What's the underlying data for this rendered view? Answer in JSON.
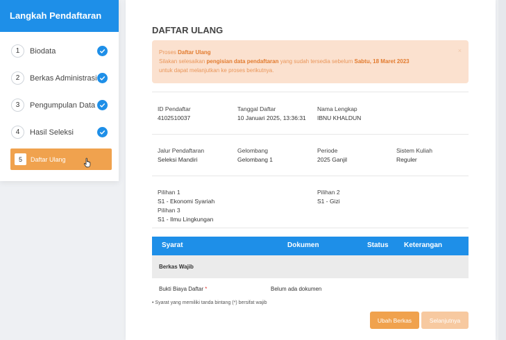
{
  "sidebar": {
    "title": "Langkah Pendaftaran",
    "steps": [
      {
        "num": "1",
        "label": "Biodata"
      },
      {
        "num": "2",
        "label": "Berkas Administrasi"
      },
      {
        "num": "3",
        "label": "Pengumpulan Data"
      },
      {
        "num": "4",
        "label": "Hasil Seleksi"
      }
    ],
    "active": {
      "num": "5",
      "label": "Daftar Ulang"
    }
  },
  "main": {
    "title": "DAFTAR ULANG",
    "alert": {
      "prefix": "Proses ",
      "process": "Daftar Ulang",
      "line2_a": "Silakan selesaikan ",
      "line2_b": "pengisian data pendaftaran",
      "line2_c": " yang sudah tersedia sebelum ",
      "deadline": "Sabtu, 18 Maret 2023",
      "line3": "untuk dapat melanjutkan ke proses berikutnya.",
      "close": "×"
    },
    "info": {
      "id_label": "ID Pendaftar",
      "id_value": "4102510037",
      "date_label": "Tanggal Daftar",
      "date_value": "10 Januari 2025, 13:36:31",
      "name_label": "Nama Lengkap",
      "name_value": "IBNU KHALDUN",
      "jalur_label": "Jalur Pendaftaran",
      "jalur_value": "Seleksi Mandiri",
      "gel_label": "Gelombang",
      "gel_value": "Gelombang 1",
      "periode_label": "Periode",
      "periode_value": "2025 Ganjil",
      "sistem_label": "Sistem Kuliah",
      "sistem_value": "Reguler",
      "p1_label": "Pilihan 1",
      "p1_value": "S1 - Ekonomi Syariah",
      "p3_label": "Pilihan 3",
      "p3_value": "S1 - Ilmu Lingkungan",
      "p2_label": "Pilihan 2",
      "p2_value": "S1 - Gizi"
    },
    "table": {
      "headers": [
        "Syarat",
        "Dokumen",
        "Status",
        "Keterangan"
      ],
      "group": "Berkas Wajib",
      "row": {
        "syarat": "Bukti Biaya Daftar",
        "required": "*",
        "dokumen": "Belum ada dokumen"
      }
    },
    "note": "Syarat yang memiliki tanda bintang (*) bersifat wajib",
    "buttons": {
      "edit": "Ubah Berkas",
      "next": "Selanjutnya"
    }
  },
  "colors": {
    "primary": "#1e8fe8",
    "accent": "#f0a24e",
    "alert_bg": "#fbe1cf"
  },
  "icons": [
    "check-icon",
    "hand-cursor-icon",
    "close-icon"
  ]
}
